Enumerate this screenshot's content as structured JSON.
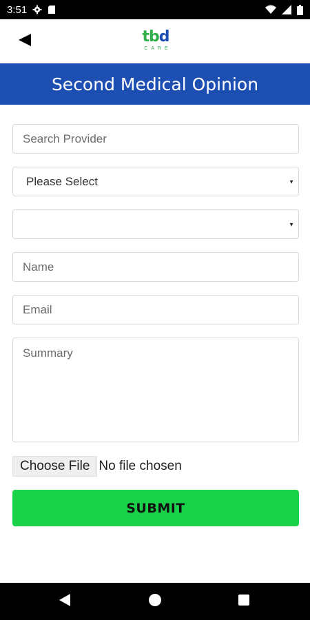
{
  "status_bar": {
    "time": "3:51",
    "icons": [
      "gear-icon",
      "sd-card-icon",
      "wifi-icon",
      "cellular-icon",
      "battery-icon"
    ]
  },
  "header": {
    "back_icon": "back-arrow-icon",
    "logo": {
      "main": "tbd",
      "sub": "CARE"
    }
  },
  "page": {
    "title": "Second Medical Opinion"
  },
  "form": {
    "search_provider": {
      "placeholder": "Search Provider",
      "value": ""
    },
    "category_select": {
      "selected": "Please Select"
    },
    "second_select": {
      "selected": ""
    },
    "name": {
      "placeholder": "Name",
      "value": ""
    },
    "email": {
      "placeholder": "Email",
      "value": ""
    },
    "summary": {
      "placeholder": "Summary",
      "value": ""
    },
    "file": {
      "button_label": "Choose File",
      "status": "No file chosen"
    },
    "submit_label": "SUBMIT"
  },
  "nav_bar": {
    "icons": [
      "nav-back-icon",
      "nav-home-icon",
      "nav-recents-icon"
    ]
  },
  "colors": {
    "banner": "#1d4fb3",
    "submit": "#19d24a",
    "logo_green": "#2fae4a",
    "logo_blue": "#1d4fb3"
  }
}
